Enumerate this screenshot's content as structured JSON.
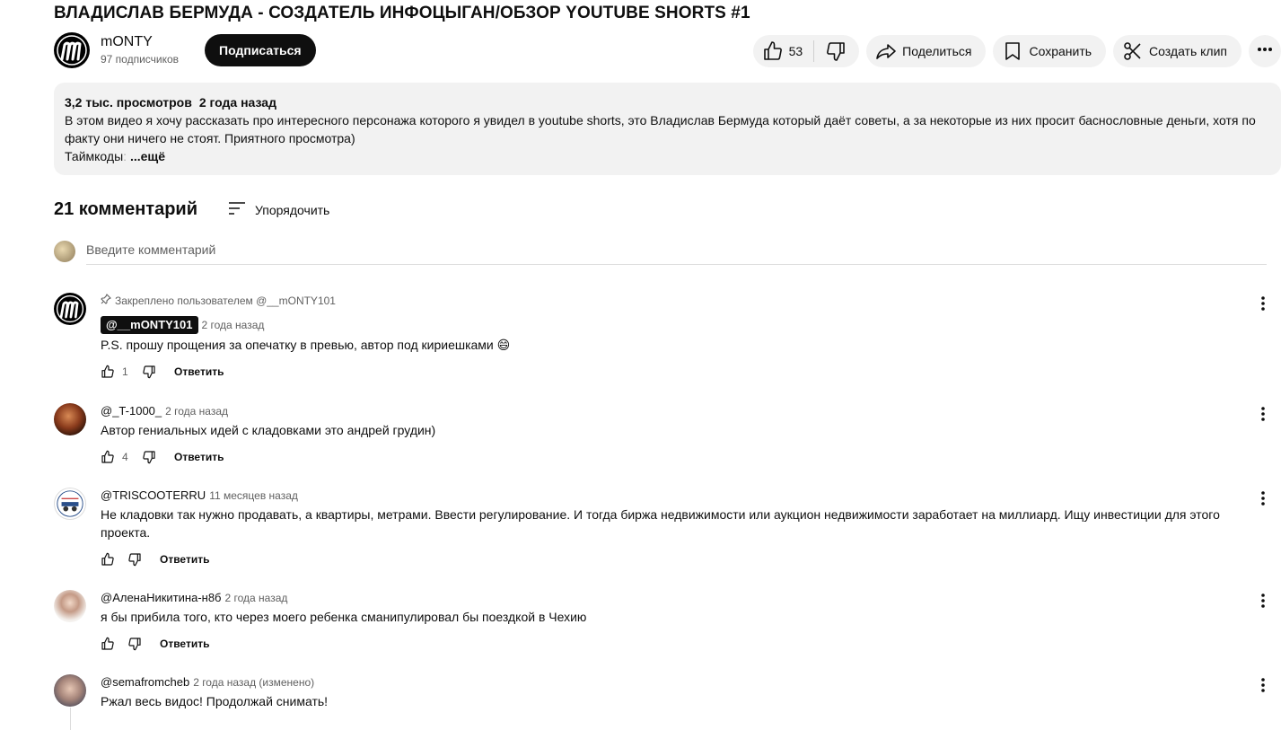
{
  "video": {
    "title": "ВЛАДИСЛАВ БЕРМУДА - СОЗДАТЕЛЬ ИНФОЦЫГАН/ОБЗОР YOUTUBE SHORTS #1"
  },
  "channel": {
    "name": "mONTY",
    "subscribers": "97 подписчиков",
    "subscribe_label": "Подписаться"
  },
  "actions": {
    "like_count": "53",
    "share_label": "Поделиться",
    "save_label": "Сохранить",
    "clip_label": "Создать клип"
  },
  "description": {
    "views": "3,2 тыс. просмотров",
    "date": "2 года назад",
    "text": "В этом видео я хочу рассказать про интересного персонажа которого я увидел в youtube shorts, это Владислав Бермуда который даёт советы, а за некоторые из них просит баснословные деньги, хотя по факту они ничего не стоят. Приятного просмотра)",
    "timecodes_label": "Таймкоды",
    "timecodes_fade": ":",
    "more_label": "...ещё"
  },
  "comments_section": {
    "count": "21 комментарий",
    "sort_label": "Упорядочить",
    "input_placeholder": "Введите комментарий"
  },
  "comments": [
    {
      "pinned_label": "Закреплено пользователем @__mONTY101",
      "author": "@__mONTY101",
      "time": "2 года назад",
      "text": "P.S. прошу прощения за опечатку в превью, автор под кириешками 😄",
      "likes": "1",
      "reply_label": "Ответить"
    },
    {
      "author": "@_T-1000_",
      "time": "2 года назад",
      "text": "Автор гениальных идей с кладовками это андрей грудин)",
      "likes": "4",
      "reply_label": "Ответить"
    },
    {
      "author": "@TRISCOOTERRU",
      "time": "11 месяцев назад",
      "text": "Не кладовки так нужно продавать, а квартиры, метрами. Ввести регулирование. И тогда биржа недвижимости или аукцион недвижимости заработает на миллиард. Ищу инвестиции для этого проекта.",
      "likes": "",
      "reply_label": "Ответить"
    },
    {
      "author": "@АленаНикитина-н8б",
      "time": "2 года назад",
      "text": "я бы прибила того, кто через моего ребенка сманипулировал бы поездкой в Чехию",
      "likes": "",
      "reply_label": "Ответить"
    },
    {
      "author": "@semafromcheb",
      "time": "2 года назад (изменено)",
      "text": "Ржал весь видос! Продолжай снимать!",
      "likes": "",
      "reply_label": ""
    }
  ],
  "colors": {
    "text": "#0f0f0f",
    "secondary": "#606060",
    "chip_bg": "#f2f2f2"
  }
}
